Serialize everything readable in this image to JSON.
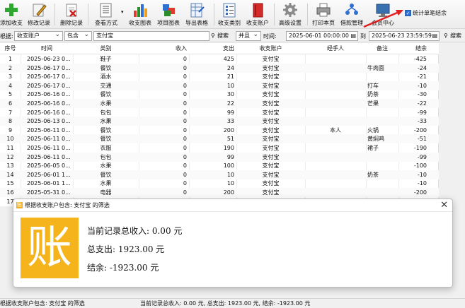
{
  "toolbar": {
    "buttons": [
      {
        "key": "add",
        "label": "添加收支",
        "icon": "add-plus-icon"
      },
      {
        "key": "edit",
        "label": "修改记录",
        "icon": "edit-pencil-icon"
      },
      {
        "key": "delete",
        "label": "删除记录",
        "icon": "delete-record-icon"
      },
      {
        "key": "view",
        "label": "查看方式",
        "icon": "view-mode-icon"
      },
      {
        "key": "chart",
        "label": "收支图表",
        "icon": "bar-chart-icon"
      },
      {
        "key": "itemchart",
        "label": "项目图表",
        "icon": "item-chart-icon"
      },
      {
        "key": "export",
        "label": "导出表格",
        "icon": "export-table-icon"
      },
      {
        "key": "category",
        "label": "收支类别",
        "icon": "category-list-icon"
      },
      {
        "key": "account",
        "label": "收支账户",
        "icon": "account-book-icon"
      },
      {
        "key": "settings",
        "label": "高级设置",
        "icon": "gear-icon"
      },
      {
        "key": "print",
        "label": "打印本页",
        "icon": "printer-icon"
      },
      {
        "key": "loan",
        "label": "借款管理",
        "icon": "loan-people-icon"
      },
      {
        "key": "member",
        "label": "会员中心",
        "icon": "monitor-icon"
      }
    ],
    "stat_checkbox_label": "统计单笔结余"
  },
  "filter": {
    "by_label": "根据:",
    "field_value": "收支账户",
    "op_value": "包含",
    "keyword_value": "支付宝",
    "search_label": "搜索",
    "logic_value": "并且",
    "time_label": "时间:",
    "date_from": "2025-06-01 00:00:00",
    "to_label": "到",
    "date_to": "2025-06-23 23:59:59",
    "search2_label": "搜索"
  },
  "table": {
    "headers": [
      "序号",
      "时间",
      "类别",
      "收入",
      "支出",
      "收支账户",
      "经手人",
      "备注",
      "结余"
    ],
    "rows": [
      [
        "1",
        "2025-06-23 0...",
        "鞋子",
        "0",
        "425",
        "支付宝",
        "",
        "",
        "-425"
      ],
      [
        "2",
        "2025-06-17 0...",
        "餐饮",
        "0",
        "24",
        "支付宝",
        "",
        "牛肉面",
        "-24"
      ],
      [
        "3",
        "2025-06-17 0...",
        "酒水",
        "0",
        "21",
        "支付宝",
        "",
        "",
        "-21"
      ],
      [
        "4",
        "2025-06-17 0...",
        "交通",
        "0",
        "10",
        "支付宝",
        "",
        "打车",
        "-10"
      ],
      [
        "5",
        "2025-06-16 0...",
        "餐饮",
        "0",
        "30",
        "支付宝",
        "",
        "奶茶",
        "-30"
      ],
      [
        "6",
        "2025-06-16 0...",
        "水果",
        "0",
        "22",
        "支付宝",
        "",
        "芒果",
        "-22"
      ],
      [
        "7",
        "2025-06-16 0...",
        "包包",
        "0",
        "99",
        "支付宝",
        "",
        "",
        "-99"
      ],
      [
        "8",
        "2025-06-13 0...",
        "水果",
        "0",
        "33",
        "支付宝",
        "",
        "",
        "-33"
      ],
      [
        "9",
        "2025-06-11 0...",
        "餐饮",
        "0",
        "200",
        "支付宝",
        "本人",
        "火锅",
        "-200"
      ],
      [
        "10",
        "2025-06-11 0...",
        "餐饮",
        "0",
        "51",
        "支付宝",
        "",
        "黄焖鸡",
        "-51"
      ],
      [
        "11",
        "2025-06-11 0...",
        "衣服",
        "0",
        "190",
        "支付宝",
        "",
        "裙子",
        "-190"
      ],
      [
        "12",
        "2025-06-11 0...",
        "包包",
        "0",
        "99",
        "支付宝",
        "",
        "",
        "-99"
      ],
      [
        "13",
        "2025-06-05 0...",
        "水果",
        "0",
        "100",
        "支付宝",
        "",
        "",
        "-100"
      ],
      [
        "14",
        "2025-06-01 1...",
        "餐饮",
        "0",
        "10",
        "支付宝",
        "",
        "奶茶",
        "-10"
      ],
      [
        "15",
        "2025-06-01 1...",
        "水果",
        "0",
        "10",
        "支付宝",
        "",
        "",
        "-10"
      ],
      [
        "16",
        "2025-05-31 0...",
        "电器",
        "0",
        "200",
        "支付宝",
        "",
        "",
        "-200"
      ],
      [
        "17",
        "",
        "",
        "",
        "",
        "",
        "",
        "",
        ""
      ]
    ]
  },
  "dialog": {
    "title": "根据收支账户包含: 支付宝 的筛选",
    "close_icon": "close-icon",
    "big_char": "账",
    "line_income": "当前记录总收入: 0.00 元",
    "line_expense": "总支出: 1923.00 元",
    "line_balance": "结余: -1923.00 元"
  },
  "status": {
    "left": "根据收支账户包含: 支付宝 的筛选",
    "right": "当前记录总收入: 0.00 元, 总支出: 1923.00 元, 结余: -1923.00 元"
  },
  "colors": {
    "accent_orange": "#f5b31c",
    "arrow_red": "#e02020",
    "checkbox_blue": "#2f6fd0"
  }
}
